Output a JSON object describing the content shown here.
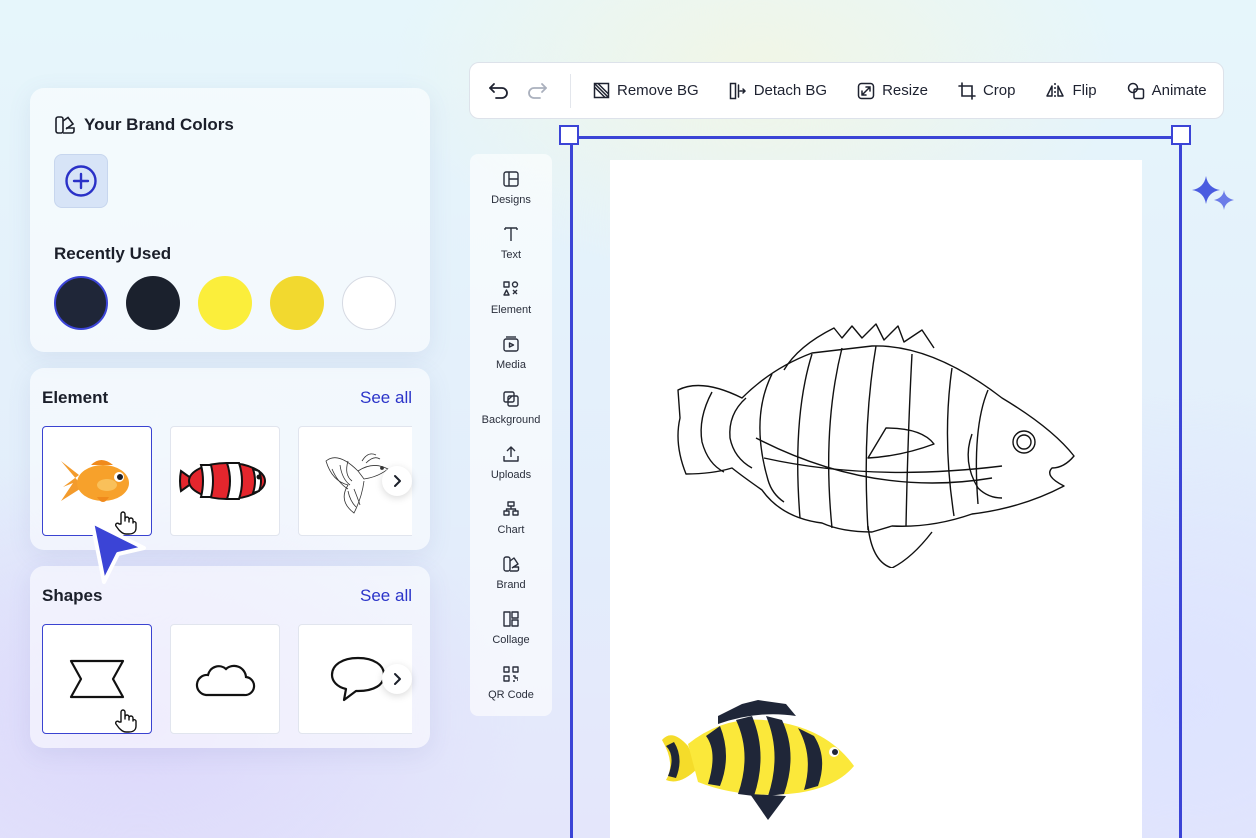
{
  "brand": {
    "title": "Your Brand Colors",
    "recent_title": "Recently Used",
    "recent_colors": [
      "#1f2638",
      "#1b212d",
      "#fbee3b",
      "#f2d92f",
      "#ffffff"
    ]
  },
  "element_section": {
    "title": "Element",
    "see_all": "See all"
  },
  "shapes_section": {
    "title": "Shapes",
    "see_all": "See all"
  },
  "toolbar": {
    "remove_bg": "Remove BG",
    "detach_bg": "Detach BG",
    "resize": "Resize",
    "crop": "Crop",
    "flip": "Flip",
    "animate": "Animate"
  },
  "sidebar": {
    "items": [
      {
        "label": "Designs",
        "icon": "designs-icon"
      },
      {
        "label": "Text",
        "icon": "text-icon"
      },
      {
        "label": "Element",
        "icon": "element-icon"
      },
      {
        "label": "Media",
        "icon": "media-icon"
      },
      {
        "label": "Background",
        "icon": "background-icon"
      },
      {
        "label": "Uploads",
        "icon": "uploads-icon"
      },
      {
        "label": "Chart",
        "icon": "chart-icon"
      },
      {
        "label": "Brand",
        "icon": "brand-icon"
      },
      {
        "label": "Collage",
        "icon": "collage-icon"
      },
      {
        "label": "QR Code",
        "icon": "qr-code-icon"
      }
    ]
  },
  "colors": {
    "accent": "#3b44d6",
    "link": "#2b34c9"
  }
}
